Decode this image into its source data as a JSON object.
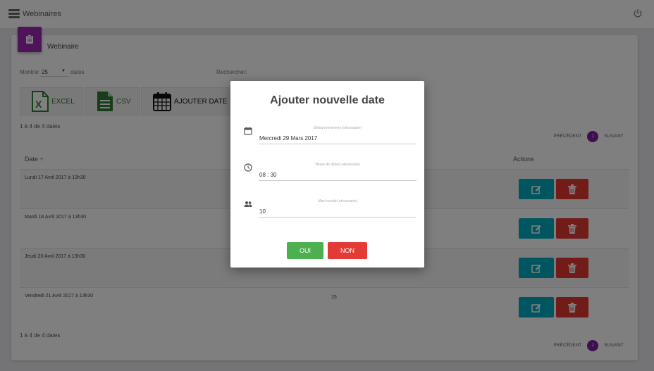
{
  "app": {
    "title": "Webinaires"
  },
  "card": {
    "title": "Webinaire"
  },
  "controls": {
    "show_label": "Montrer",
    "page_size": "25",
    "show_suffix": "dates",
    "search_label": "Rechercher:"
  },
  "export": {
    "excel": "EXCEL",
    "csv": "CSV",
    "add": "AJOUTER DATE"
  },
  "info_top": "1 à 4 de 4 dates",
  "info_bottom": "1 à 4 de 4 dates",
  "pager": {
    "prev": "PRÉCÉDENT",
    "page": "1",
    "next": "SUIVANT"
  },
  "table": {
    "col_date": "Date ÷",
    "col_actions": "Actions",
    "rows": [
      {
        "date": "Lundi 17 Avril 2017 à 13h30",
        "count": ""
      },
      {
        "date": "Mardi 18 Avril 2017 à 13h30",
        "count": ""
      },
      {
        "date": "Jeudi 20 Avril 2017 à 13h30",
        "count": ""
      },
      {
        "date": "Vendredi 21 Avril 2017 à 13h30",
        "count": "15"
      }
    ]
  },
  "modal": {
    "title": "Ajouter nouvelle date",
    "fields": [
      {
        "label": "Début événement (nécessaire)",
        "value": "Mercredi 29 Mars 2017",
        "icon": "calendar-icon"
      },
      {
        "label": "Heure de début (nécessaire)",
        "value": "08 : 30",
        "icon": "clock-icon"
      },
      {
        "label": "Max inscrits (nécessaire)",
        "value": "10",
        "icon": "people-icon"
      }
    ],
    "yes": "OUI",
    "no": "NON"
  },
  "colors": {
    "accent": "#9c27b0",
    "edit": "#00acc1",
    "delete": "#e53935",
    "yes": "#4caf50",
    "export_icon": "#2e7d32"
  }
}
